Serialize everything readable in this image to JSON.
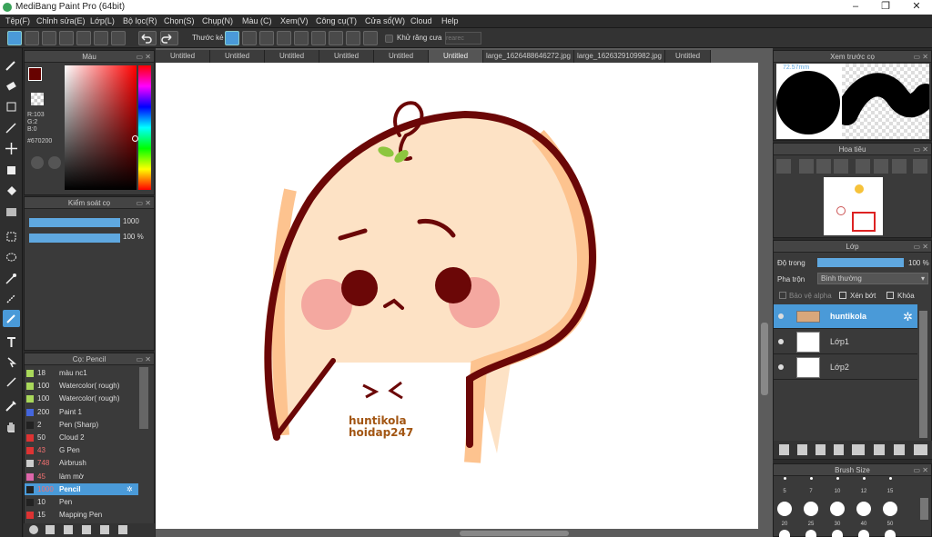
{
  "window": {
    "title": "MediBang Paint Pro (64bit)"
  },
  "menu": [
    "Tệp(F)",
    "Chỉnh sửa(E)",
    "Lớp(L)",
    "Bộ lọc(R)",
    "Chọn(S)",
    "Chụp(N)",
    "Màu (C)",
    "Xem(V)",
    "Công cụ(T)",
    "Cửa sổ(W)",
    "Cloud",
    "Help"
  ],
  "toolbar": {
    "ruler_label": "Thước kẻ",
    "antialias_label": "Khử răng cưa",
    "field_placeholder": "rearec"
  },
  "color_panel": {
    "title": "Màu",
    "r": "R:103",
    "g": "G:2",
    "b": "B:0",
    "hex": "#670200",
    "fg": "#670200"
  },
  "brush_control": {
    "title": "Kiểm soát cọ",
    "size": "1000",
    "opacity": "100 %"
  },
  "brush_panel": {
    "title": "Cọ: Pencil",
    "items": [
      {
        "size": "18",
        "name": "màu nc1",
        "color": "#a9d85a"
      },
      {
        "size": "100",
        "name": "Watercolor( rough)",
        "color": "#a9d85a"
      },
      {
        "size": "100",
        "name": "Watercolor( rough)",
        "color": "#a9d85a"
      },
      {
        "size": "200",
        "name": "Paint 1",
        "color": "#4466dd"
      },
      {
        "size": "2",
        "name": "Pen (Sharp)",
        "color": "#222222"
      },
      {
        "size": "50",
        "name": "Cloud 2",
        "color": "#dd3333"
      },
      {
        "size": "43",
        "name": "G Pen",
        "color": "#dd3333"
      },
      {
        "size": "748",
        "name": "Airbrush",
        "color": "#cccccc"
      },
      {
        "size": "45",
        "name": "làm mờ",
        "color": "#dd66aa"
      },
      {
        "size": "1000",
        "name": "Pencil",
        "color": "#222222"
      },
      {
        "size": "10",
        "name": "Pen",
        "color": "#222222"
      },
      {
        "size": "15",
        "name": "Mapping Pen",
        "color": "#dd3333"
      }
    ]
  },
  "tabs": [
    "Untitled",
    "Untitled",
    "Untitled",
    "Untitled",
    "Untitled",
    "Untitled",
    "large_1626488646272.jpg",
    "large_1626329109982.jpg",
    "Untitled"
  ],
  "canvas": {
    "watermark1": "huntikola",
    "watermark2": "hoidap247"
  },
  "preview_panel": {
    "title": "Xem trước cọ",
    "size_label": "72.57mm"
  },
  "navigator_panel": {
    "title": "Hoa tiêu"
  },
  "layer_panel": {
    "title": "Lớp",
    "opacity_label": "Độ trong",
    "opacity_value": "100 %",
    "blend_label": "Pha trộn",
    "blend_value": "Bình thường",
    "protect_alpha": "Bảo vệ alpha",
    "clipping": "Xén bớt",
    "lock": "Khóa",
    "layers": [
      "huntikola",
      "Lớp1",
      "Lớp2"
    ]
  },
  "brush_size_panel": {
    "title": "Brush Size",
    "labels": [
      "5",
      "7",
      "10",
      "12",
      "15",
      "20",
      "25",
      "30",
      "40",
      "50"
    ]
  }
}
